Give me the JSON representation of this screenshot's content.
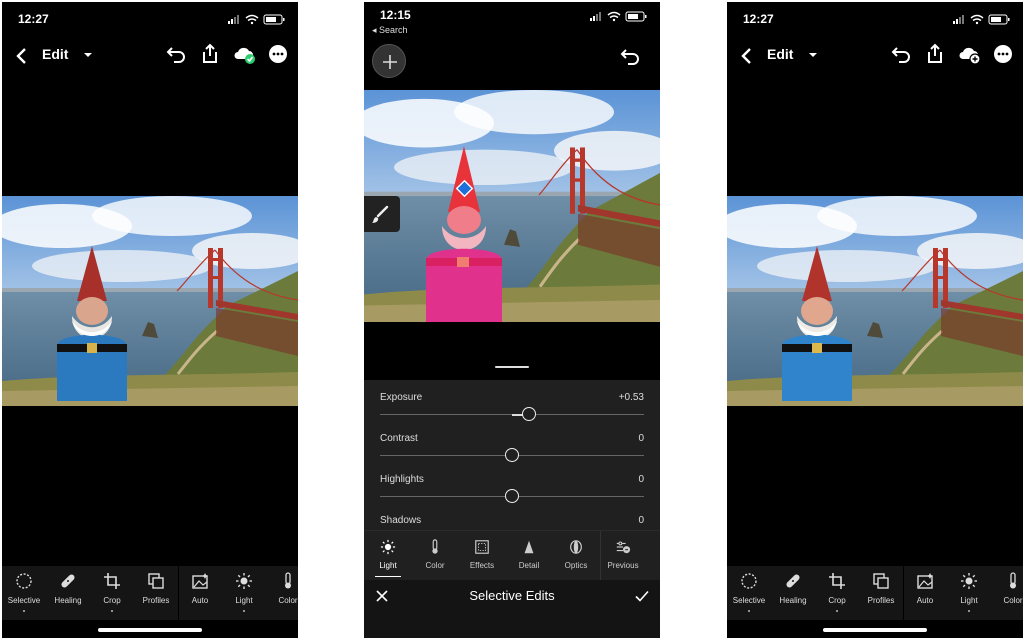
{
  "left_phone": {
    "status": {
      "time": "12:27"
    },
    "nav": {
      "title": "Edit"
    },
    "toolbar": [
      {
        "label": "Selective",
        "icon": "selective-icon"
      },
      {
        "label": "Healing",
        "icon": "healing-icon"
      },
      {
        "label": "Crop",
        "icon": "crop-icon"
      },
      {
        "label": "Profiles",
        "icon": "profiles-icon"
      },
      {
        "label": "Auto",
        "icon": "auto-icon"
      },
      {
        "label": "Light",
        "icon": "light-icon"
      },
      {
        "label": "Color",
        "icon": "color-icon"
      }
    ]
  },
  "mid_phone": {
    "status": {
      "time": "12:15",
      "back_hint": "◂ Search"
    },
    "sliders": [
      {
        "name": "Exposure",
        "value": "+0.53",
        "position": 0.53
      },
      {
        "name": "Contrast",
        "value": "0",
        "position": 0
      },
      {
        "name": "Highlights",
        "value": "0",
        "position": 0
      },
      {
        "name": "Shadows",
        "value": "0",
        "position": 0
      }
    ],
    "tabs": [
      {
        "label": "Light",
        "icon": "light-icon",
        "active": true
      },
      {
        "label": "Color",
        "icon": "color-icon"
      },
      {
        "label": "Effects",
        "icon": "effects-icon"
      },
      {
        "label": "Detail",
        "icon": "detail-icon"
      },
      {
        "label": "Optics",
        "icon": "optics-icon"
      },
      {
        "label": "Previous",
        "icon": "previous-icon"
      }
    ],
    "bottom_bar": {
      "title": "Selective Edits"
    }
  },
  "right_phone": {
    "status": {
      "time": "12:27"
    },
    "nav": {
      "title": "Edit"
    },
    "toolbar": [
      {
        "label": "Selective",
        "icon": "selective-icon"
      },
      {
        "label": "Healing",
        "icon": "healing-icon"
      },
      {
        "label": "Crop",
        "icon": "crop-icon"
      },
      {
        "label": "Profiles",
        "icon": "profiles-icon"
      },
      {
        "label": "Auto",
        "icon": "auto-icon"
      },
      {
        "label": "Light",
        "icon": "light-icon"
      },
      {
        "label": "Color",
        "icon": "color-icon"
      }
    ]
  },
  "colors": {
    "background": "#000000",
    "toolbar": "#151515",
    "panel": "#202020",
    "sync_ok": "#2ecc71",
    "selection_marker": "#1e6fd9"
  }
}
